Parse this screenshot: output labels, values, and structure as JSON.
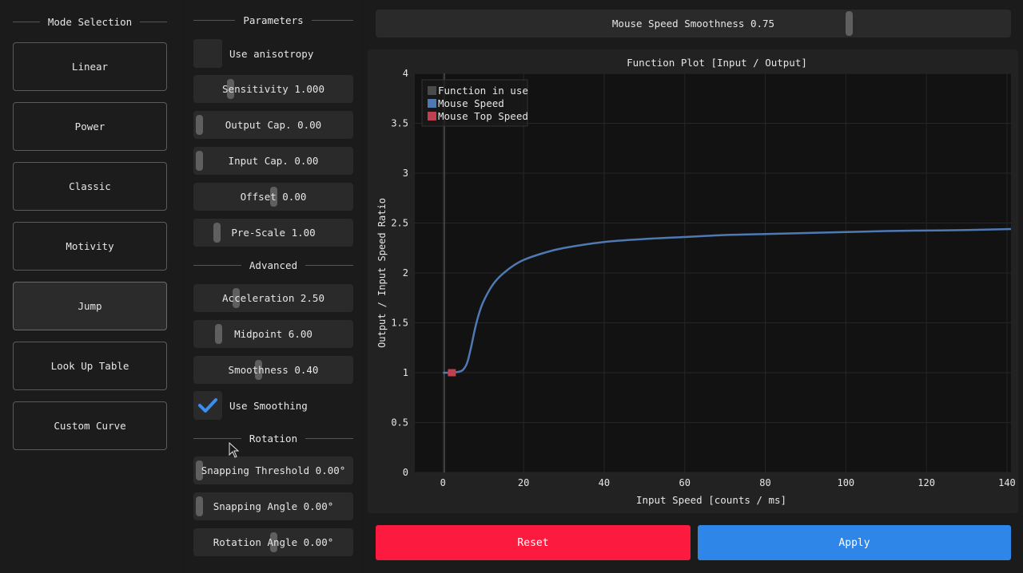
{
  "mode_selection": {
    "title": "Mode Selection",
    "modes": [
      {
        "label": "Linear",
        "active": false
      },
      {
        "label": "Power",
        "active": false
      },
      {
        "label": "Classic",
        "active": false
      },
      {
        "label": "Motivity",
        "active": false
      },
      {
        "label": "Jump",
        "active": true
      },
      {
        "label": "Look Up Table",
        "active": false
      },
      {
        "label": "Custom Curve",
        "active": false
      }
    ]
  },
  "parameters": {
    "title": "Parameters",
    "use_anisotropy": {
      "label": "Use anisotropy",
      "checked": false
    },
    "sliders": [
      {
        "label": "Sensitivity 1.000",
        "position": 0.21
      },
      {
        "label": "Output Cap. 0.00",
        "position": 0.0
      },
      {
        "label": "Input Cap. 0.00",
        "position": 0.0
      },
      {
        "label": "Offset 0.00",
        "position": 0.5
      },
      {
        "label": "Pre-Scale 1.00",
        "position": 0.12
      }
    ]
  },
  "advanced": {
    "title": "Advanced",
    "sliders": [
      {
        "label": "Acceleration 2.50",
        "position": 0.25
      },
      {
        "label": "Midpoint 6.00",
        "position": 0.13
      },
      {
        "label": "Smoothness 0.40",
        "position": 0.4
      }
    ],
    "use_smoothing": {
      "label": "Use Smoothing",
      "checked": true
    }
  },
  "rotation": {
    "title": "Rotation",
    "sliders": [
      {
        "label": "Snapping Threshold 0.00°",
        "position": 0.0
      },
      {
        "label": "Snapping Angle 0.00°",
        "position": 0.0
      },
      {
        "label": "Rotation Angle 0.00°",
        "position": 0.5
      }
    ]
  },
  "mouse_speed_smoothness": {
    "label": "Mouse Speed Smoothness 0.75",
    "position": 0.75
  },
  "buttons": {
    "reset": "Reset",
    "apply": "Apply"
  },
  "colors": {
    "reset": "#fc1a3f",
    "apply": "#2e86e8",
    "function_in_use": "#4a4a4a",
    "mouse_speed": "#4f79b3",
    "mouse_top_speed": "#c0404f",
    "check": "#3a8ef0"
  },
  "chart_data": {
    "type": "line",
    "title": "Function Plot [Input / Output]",
    "xlabel": "Input Speed [counts / ms]",
    "ylabel": "Output / Input Speed Ratio",
    "xlim": [
      -7,
      141
    ],
    "ylim": [
      0,
      4
    ],
    "x_ticks": [
      "0",
      "20",
      "40",
      "60",
      "80",
      "100",
      "120",
      "140"
    ],
    "y_ticks": [
      "0",
      "0.5",
      "1",
      "1.5",
      "2",
      "2.5",
      "3",
      "3.5",
      "4"
    ],
    "legend": {
      "placement": "top-left",
      "entries": [
        "Function in use",
        "Mouse Speed",
        "Mouse Top Speed"
      ]
    },
    "series": [
      {
        "name": "Mouse Speed",
        "x": [
          0,
          2,
          4,
          5,
          6,
          7,
          8,
          9,
          10,
          12,
          14,
          17,
          20,
          25,
          30,
          40,
          50,
          60,
          70,
          80,
          90,
          100,
          110,
          120,
          130,
          141
        ],
        "y": [
          1.0,
          1.0,
          1.01,
          1.03,
          1.1,
          1.26,
          1.45,
          1.6,
          1.71,
          1.86,
          1.96,
          2.06,
          2.13,
          2.2,
          2.25,
          2.31,
          2.34,
          2.36,
          2.38,
          2.39,
          2.4,
          2.41,
          2.42,
          2.425,
          2.43,
          2.44
        ]
      }
    ],
    "top_speed_marker": {
      "x": 2.2,
      "y": 1.0
    }
  }
}
